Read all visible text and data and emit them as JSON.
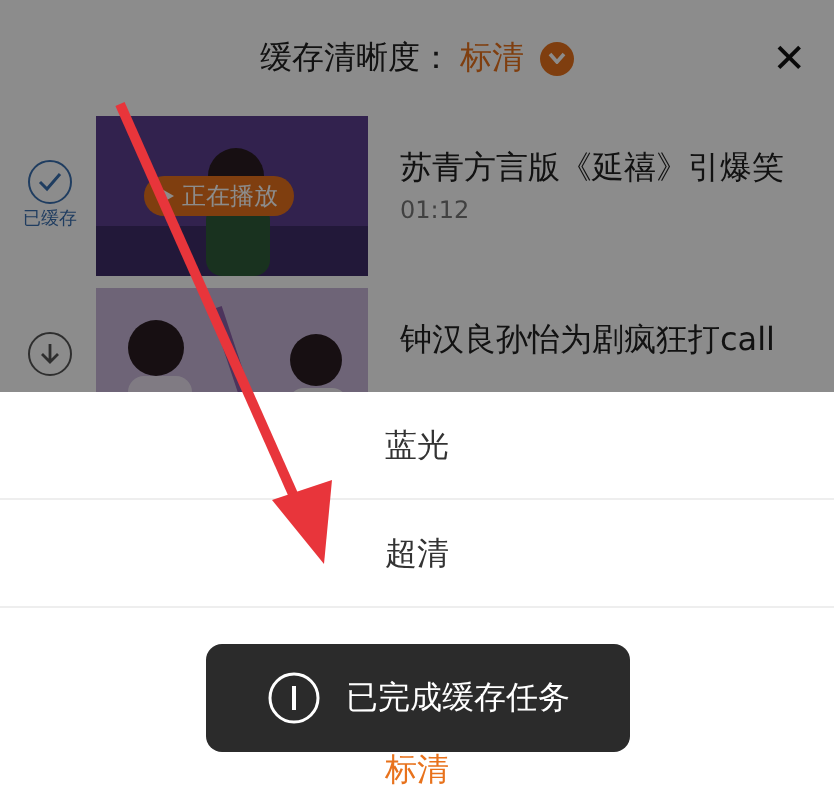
{
  "header": {
    "label": "缓存清晰度：",
    "value": "标清",
    "close": "✕"
  },
  "videos": [
    {
      "title": "苏青方言版《延禧》引爆笑",
      "duration": "01:12",
      "cached": true,
      "status_label": "已缓存",
      "playing_badge": "正在播放"
    },
    {
      "title": "钟汉良孙怡为剧疯狂打call",
      "cached": false
    }
  ],
  "quality_options": [
    {
      "label": "蓝光",
      "selected": false
    },
    {
      "label": "超清",
      "selected": false
    },
    {
      "label": "标清",
      "selected": true
    }
  ],
  "toast": {
    "text": "已完成缓存任务"
  }
}
